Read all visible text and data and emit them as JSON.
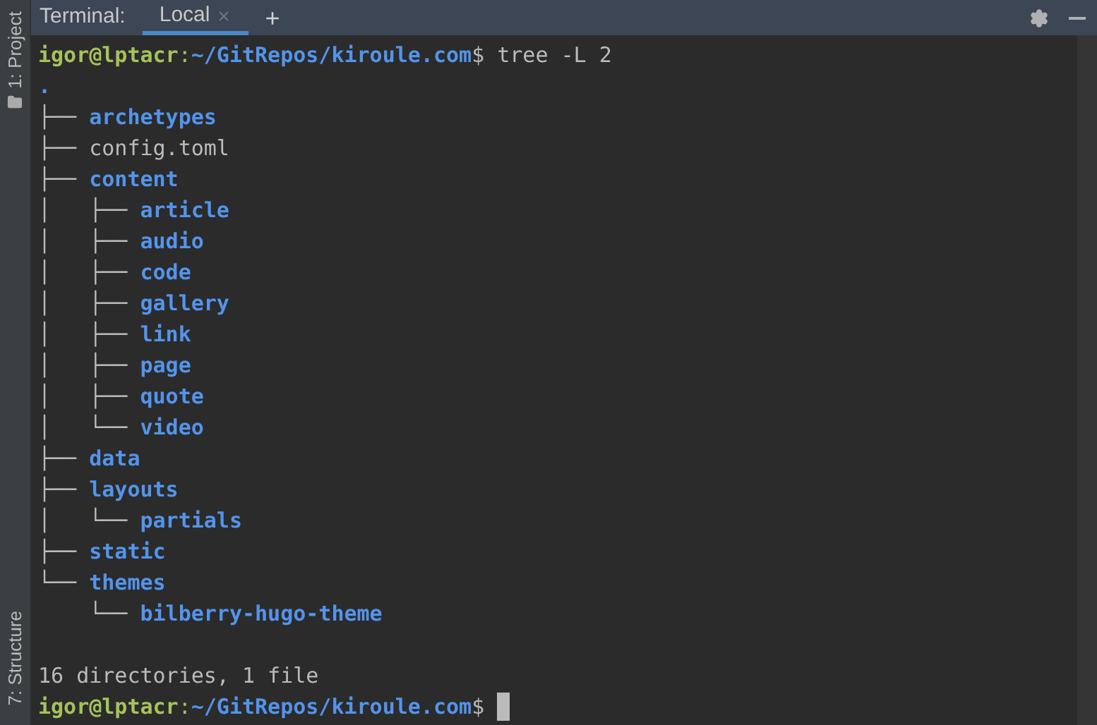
{
  "side_tabs": [
    {
      "label": "1: Project"
    },
    {
      "label": "7: Structure"
    }
  ],
  "header": {
    "title": "Terminal:",
    "tabs": [
      {
        "label": "Local",
        "selected": true
      }
    ],
    "add": "+"
  },
  "lines": [
    {
      "kind": "prompt",
      "user": "igor@lptacr",
      "sep": ":",
      "path": "~/GitRepos/kiroule.com",
      "dollar": "$",
      "command": " tree -L 2"
    },
    {
      "kind": "dir",
      "name": "."
    },
    {
      "kind": "dir",
      "prefix": "├── ",
      "name": "archetypes"
    },
    {
      "kind": "file",
      "prefix": "├── ",
      "name": "config.toml"
    },
    {
      "kind": "dir",
      "prefix": "├── ",
      "name": "content"
    },
    {
      "kind": "dir",
      "prefix": "│   ├── ",
      "name": "article"
    },
    {
      "kind": "dir",
      "prefix": "│   ├── ",
      "name": "audio"
    },
    {
      "kind": "dir",
      "prefix": "│   ├── ",
      "name": "code"
    },
    {
      "kind": "dir",
      "prefix": "│   ├── ",
      "name": "gallery"
    },
    {
      "kind": "dir",
      "prefix": "│   ├── ",
      "name": "link"
    },
    {
      "kind": "dir",
      "prefix": "│   ├── ",
      "name": "page"
    },
    {
      "kind": "dir",
      "prefix": "│   ├── ",
      "name": "quote"
    },
    {
      "kind": "dir",
      "prefix": "│   └── ",
      "name": "video"
    },
    {
      "kind": "dir",
      "prefix": "├── ",
      "name": "data"
    },
    {
      "kind": "dir",
      "prefix": "├── ",
      "name": "layouts"
    },
    {
      "kind": "dir",
      "prefix": "│   └── ",
      "name": "partials"
    },
    {
      "kind": "dir",
      "prefix": "├── ",
      "name": "static"
    },
    {
      "kind": "dir",
      "prefix": "└── ",
      "name": "themes"
    },
    {
      "kind": "dir",
      "prefix": "    └── ",
      "name": "bilberry-hugo-theme"
    },
    {
      "kind": "blank"
    },
    {
      "kind": "text",
      "text": "16 directories, 1 file"
    },
    {
      "kind": "prompt",
      "user": "igor@lptacr",
      "sep": ":",
      "path": "~/GitRepos/kiroule.com",
      "dollar": "$",
      "cursor": true
    }
  ]
}
